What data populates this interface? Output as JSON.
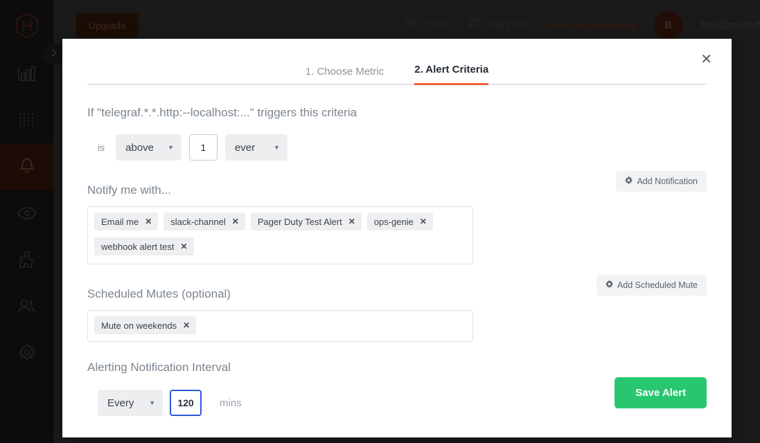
{
  "app": {
    "logo_icon": "hexagon-h-logo",
    "upgrade_label": "Upgrade",
    "collapse_icon": "chevron-right-icon",
    "sidebar_items": [
      {
        "icon": "bar-chart-icon",
        "name": "dashboards",
        "active": false
      },
      {
        "icon": "sliders-icon",
        "name": "metrics",
        "active": false
      },
      {
        "icon": "bell-icon",
        "name": "alerts",
        "active": true
      },
      {
        "icon": "eye-icon",
        "name": "monitoring",
        "active": false
      },
      {
        "icon": "puzzle-icon",
        "name": "integrations",
        "active": false
      },
      {
        "icon": "users-icon",
        "name": "team",
        "active": false
      },
      {
        "icon": "gear-icon",
        "name": "settings",
        "active": false
      }
    ],
    "topbar": {
      "docs_label": "Docs",
      "docs_icon": "docs-icon",
      "support_label": "Support",
      "support_icon": "chat-bubble-icon",
      "admin_label": "Admin impersonating",
      "avatar_initial": "B",
      "user_email": "ben@metricf"
    }
  },
  "modal": {
    "close_icon": "close-icon",
    "tabs": [
      {
        "label": "1. Choose Metric",
        "active": false
      },
      {
        "label": "2. Alert Criteria",
        "active": true
      }
    ],
    "criteria": {
      "heading": "If \"telegraf.*.*.http:--localhost:...\" triggers this criteria",
      "is_label": "is",
      "comparator": "above",
      "threshold": "1",
      "frequency": "ever",
      "caret_icon": "chevron-down-icon"
    },
    "notify": {
      "title": "Notify me with...",
      "add_button_label": "Add Notification",
      "add_button_icon": "gear-icon",
      "tags": [
        "Email me",
        "slack-channel",
        "Pager Duty Test Alert",
        "ops-genie",
        "webhook alert test"
      ],
      "remove_icon": "close-icon"
    },
    "mutes": {
      "title": "Scheduled Mutes (optional)",
      "add_button_label": "Add Scheduled Mute",
      "add_button_icon": "gear-icon",
      "tags": [
        "Mute on weekends"
      ],
      "remove_icon": "close-icon"
    },
    "interval": {
      "title": "Alerting Notification Interval",
      "mode": "Every",
      "value": "120",
      "units_label": "mins",
      "caret_icon": "chevron-down-icon"
    },
    "save_label": "Save Alert"
  },
  "colors": {
    "accent_orange": "#f0603c",
    "save_green": "#28c76f",
    "focus_blue": "#2d5bd7",
    "sidebar_active": "#401c0c"
  }
}
